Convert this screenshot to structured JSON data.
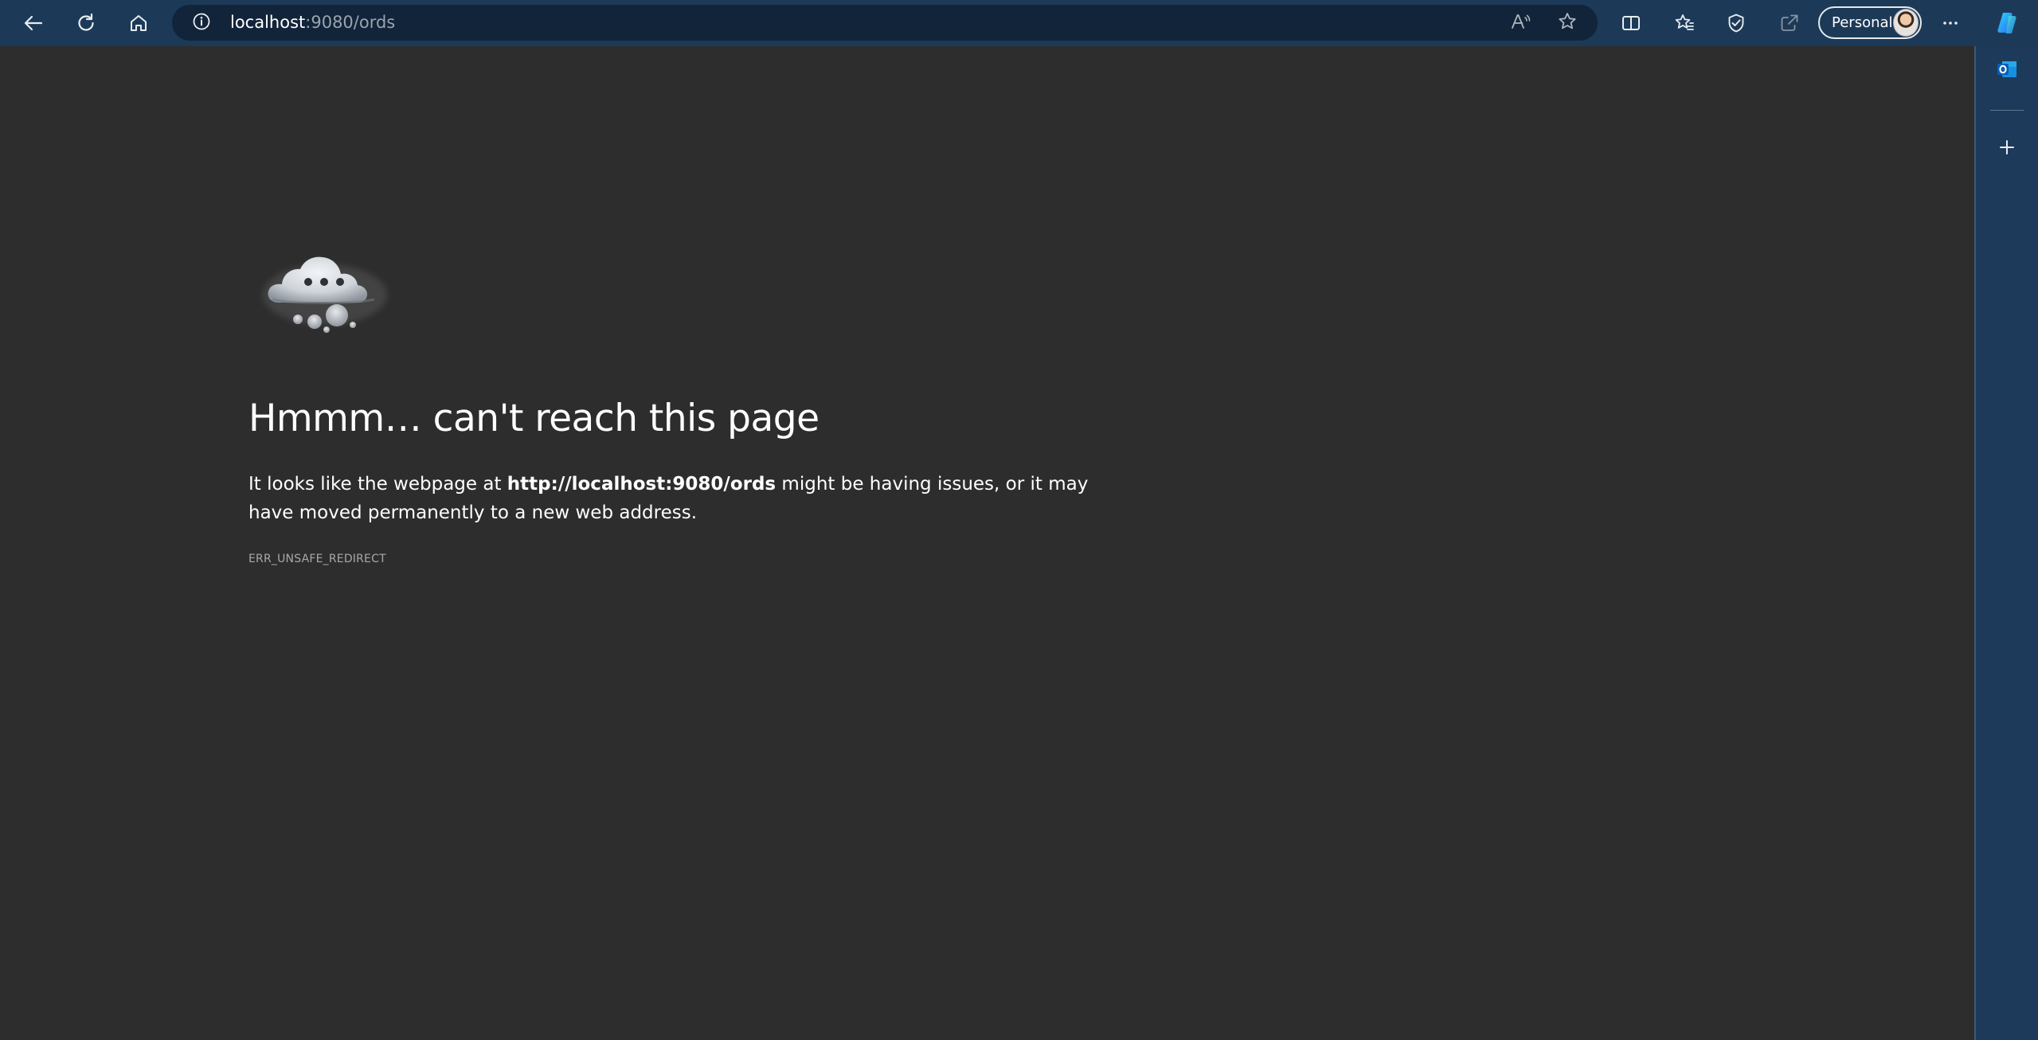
{
  "browser": {
    "address": {
      "host": "localhost",
      "path": ":9080/ords"
    },
    "profile": {
      "label": "Personal"
    },
    "icons": {
      "back": "back-arrow-icon",
      "refresh": "refresh-icon",
      "home": "home-icon",
      "site_info": "info-icon",
      "read_aloud": "read-aloud-icon",
      "favorite": "star-icon",
      "split_screen": "split-screen-icon",
      "favorites": "favorites-icon",
      "browser_essentials": "browser-essentials-icon",
      "share": "share-icon",
      "more": "more-icon",
      "copilot": "copilot-icon"
    }
  },
  "sidebar": {
    "icons": {
      "outlook": "outlook-icon",
      "add": "plus-icon"
    }
  },
  "error_page": {
    "headline": "Hmmm… can't reach this page",
    "message_prefix": "It looks like the webpage at ",
    "message_url": "http://localhost:9080/ords",
    "message_suffix": " might be having issues, or it may have moved permanently to a new web address.",
    "error_code": "ERR_UNSAFE_REDIRECT"
  },
  "colors": {
    "toolbar": "#1c3a58",
    "address_bar": "#12243a",
    "page_background": "#2d2d2d",
    "sidebar": "#1e3a5a"
  }
}
